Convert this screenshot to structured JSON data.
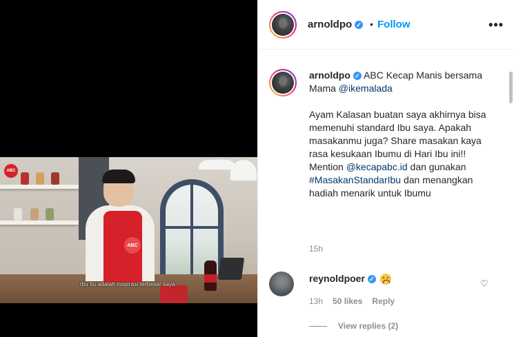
{
  "header": {
    "username": "arnoldpo",
    "verified_icon": "verified-badge-icon",
    "separator": "•",
    "follow_label": "Follow",
    "more_label": "•••"
  },
  "video": {
    "brand_badge": "ABC",
    "apron_logo": "ABC",
    "subtitle": "Ibu itu adalah inspirasi terbesar saya"
  },
  "caption": {
    "username": "arnoldpo",
    "line1_text": "ABC Kecap Manis bersama Mama",
    "line1_mention": "@ikemalada",
    "para1": "Ayam Kalasan buatan saya akhirnya bisa memenuhi standard Ibu saya. Apakah masakanmu juga? Share masakan kaya rasa kesukaan Ibumu di Hari Ibu ini!! Mention",
    "para_mention": "@kecapabc.id",
    "para2": "dan gunakan",
    "hashtag": "#MasakanStandarIbu",
    "para3": "dan menangkan hadiah menarik untuk Ibumu",
    "time": "15h"
  },
  "comment": {
    "username": "reynoldpoer",
    "emoji_icon": "tired-face-emoji-icon",
    "time": "13h",
    "likes": "50 likes",
    "reply_label": "Reply",
    "view_replies": "View replies (2)",
    "heart_icon": "heart-icon"
  },
  "colors": {
    "link": "#00376b",
    "follow": "#0095f6",
    "verified": "#3897f0",
    "apron": "#d6202a"
  }
}
